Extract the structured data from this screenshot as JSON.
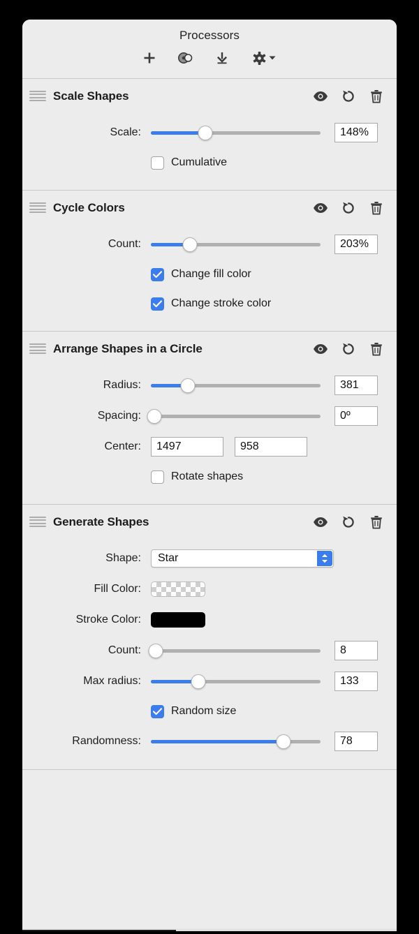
{
  "window": {
    "title": "Processors"
  },
  "toolbar": {
    "buttons": [
      {
        "name": "add-processor-button",
        "icon": "plus-icon",
        "label": "+"
      },
      {
        "name": "merge-shapes-button",
        "icon": "overlapping-circles-icon",
        "label": ""
      },
      {
        "name": "download-button",
        "icon": "download-icon",
        "label": ""
      },
      {
        "name": "settings-menu-button",
        "icon": "gear-icon",
        "label": ""
      }
    ]
  },
  "header_actions": {
    "visibility_label": "Toggle visibility",
    "reset_label": "Reset",
    "delete_label": "Delete"
  },
  "sections": [
    {
      "id": "scale-shapes",
      "title": "Scale Shapes",
      "controls": [
        {
          "kind": "slider",
          "label": "Scale:",
          "value": "148%",
          "percent": 32
        },
        {
          "kind": "checkbox",
          "label": "Cumulative",
          "checked": false
        }
      ]
    },
    {
      "id": "cycle-colors",
      "title": "Cycle Colors",
      "controls": [
        {
          "kind": "slider",
          "label": "Count:",
          "value": "203%",
          "percent": 23
        },
        {
          "kind": "checkbox",
          "label": "Change fill color",
          "checked": true
        },
        {
          "kind": "checkbox",
          "label": "Change stroke color",
          "checked": true
        }
      ]
    },
    {
      "id": "arrange-shapes-in-a-circle",
      "title": "Arrange Shapes in a Circle",
      "controls": [
        {
          "kind": "slider",
          "label": "Radius:",
          "value": "381",
          "percent": 22
        },
        {
          "kind": "slider",
          "label": "Spacing:",
          "value": "0º",
          "percent": 0
        },
        {
          "kind": "pair",
          "label": "Center:",
          "value_x": "1497",
          "value_y": "958"
        },
        {
          "kind": "checkbox",
          "label": "Rotate shapes",
          "checked": false
        }
      ]
    },
    {
      "id": "generate-shapes",
      "title": "Generate Shapes",
      "controls": [
        {
          "kind": "popup",
          "label": "Shape:",
          "value": "Star",
          "options": [
            "Star"
          ]
        },
        {
          "kind": "color",
          "label": "Fill Color:",
          "value": "transparent"
        },
        {
          "kind": "color",
          "label": "Stroke Color:",
          "value": "#000000"
        },
        {
          "kind": "slider",
          "label": "Count:",
          "value": "8",
          "percent": 2
        },
        {
          "kind": "slider",
          "label": "Max radius:",
          "value": "133",
          "percent": 28
        },
        {
          "kind": "checkbox",
          "label": "Random size",
          "checked": true
        },
        {
          "kind": "slider",
          "label": "Randomness:",
          "value": "78",
          "percent": 78
        }
      ]
    }
  ],
  "colors": {
    "accent": "#3b7ded",
    "window_bg": "#ececec",
    "track": "#b0b0b0",
    "divider": "#c9c9c9"
  }
}
